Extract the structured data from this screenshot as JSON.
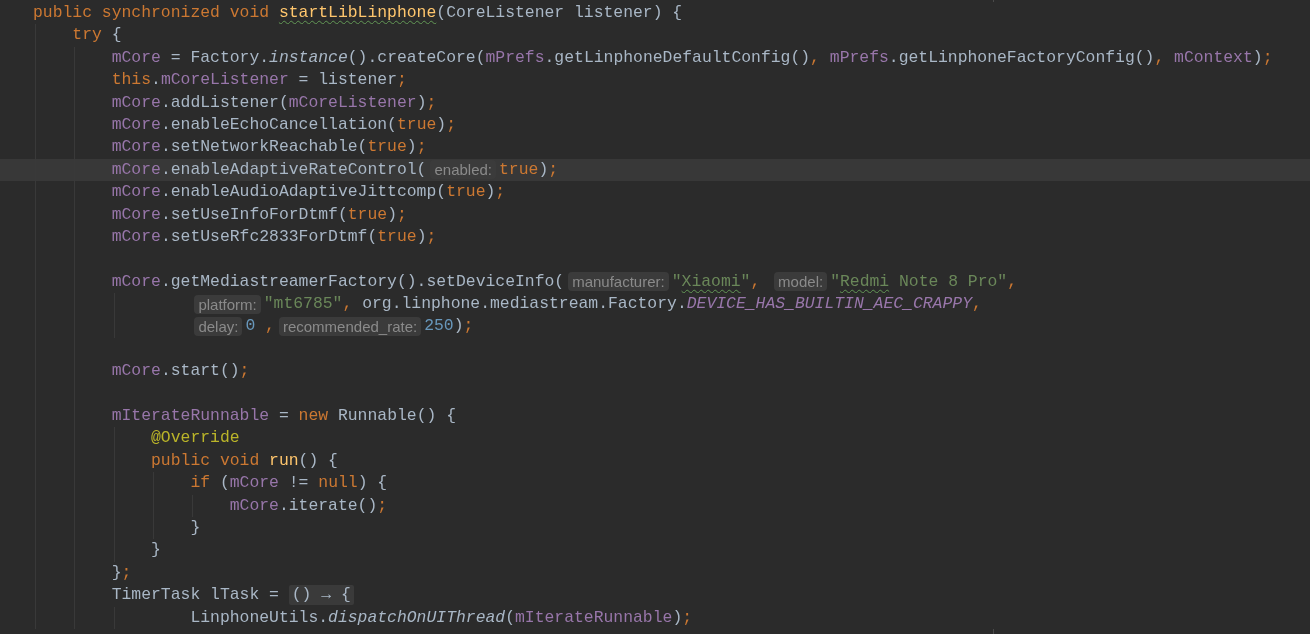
{
  "editor": {
    "lines": [
      {
        "kind": "code",
        "current": false,
        "segments": [
          {
            "kind": "code",
            "tokens": [
              {
                "kind": "kw",
                "text": "public synchronized void "
              },
              {
                "kind": "decl_misspelled",
                "text": "startLibLinphone"
              },
              {
                "kind": "plain",
                "text": "(CoreListener listener) {"
              }
            ]
          }
        ],
        "children": [
          {
            "kind": "code",
            "current": false,
            "segments": [
              {
                "kind": "code",
                "tokens": [
                  {
                    "kind": "kw",
                    "text": "try"
                  },
                  {
                    "kind": "plain",
                    "text": " {"
                  }
                ]
              }
            ],
            "children": [
              {
                "kind": "code",
                "current": false,
                "segments": [
                  {
                    "kind": "code",
                    "tokens": [
                      {
                        "kind": "field",
                        "text": "mCore"
                      },
                      {
                        "kind": "plain",
                        "text": " = Factory."
                      },
                      {
                        "kind": "static",
                        "text": "instance"
                      },
                      {
                        "kind": "plain",
                        "text": "().createCore("
                      },
                      {
                        "kind": "field",
                        "text": "mPrefs"
                      },
                      {
                        "kind": "plain",
                        "text": ".getLinphoneDefaultConfig()"
                      },
                      {
                        "kind": "punct",
                        "text": ", "
                      },
                      {
                        "kind": "field",
                        "text": "mPrefs"
                      },
                      {
                        "kind": "plain",
                        "text": ".getLinphoneFactoryConfig()"
                      },
                      {
                        "kind": "punct",
                        "text": ", "
                      },
                      {
                        "kind": "field",
                        "text": "mContext"
                      },
                      {
                        "kind": "plain",
                        "text": ")"
                      },
                      {
                        "kind": "punct",
                        "text": ";"
                      }
                    ]
                  }
                ]
              },
              {
                "kind": "code",
                "current": false,
                "segments": [
                  {
                    "kind": "code",
                    "tokens": [
                      {
                        "kind": "kw",
                        "text": "this"
                      },
                      {
                        "kind": "plain",
                        "text": "."
                      },
                      {
                        "kind": "field",
                        "text": "mCoreListener"
                      },
                      {
                        "kind": "plain",
                        "text": " = listener"
                      },
                      {
                        "kind": "punct",
                        "text": ";"
                      }
                    ]
                  }
                ]
              },
              {
                "kind": "code",
                "current": false,
                "segments": [
                  {
                    "kind": "code",
                    "tokens": [
                      {
                        "kind": "field",
                        "text": "mCore"
                      },
                      {
                        "kind": "plain",
                        "text": ".addListener("
                      },
                      {
                        "kind": "field",
                        "text": "mCoreListener"
                      },
                      {
                        "kind": "plain",
                        "text": ")"
                      },
                      {
                        "kind": "punct",
                        "text": ";"
                      }
                    ]
                  }
                ]
              },
              {
                "kind": "code",
                "current": false,
                "segments": [
                  {
                    "kind": "code",
                    "tokens": [
                      {
                        "kind": "field",
                        "text": "mCore"
                      },
                      {
                        "kind": "plain",
                        "text": ".enableEchoCancellation("
                      },
                      {
                        "kind": "kw",
                        "text": "true"
                      },
                      {
                        "kind": "plain",
                        "text": ")"
                      },
                      {
                        "kind": "punct",
                        "text": ";"
                      }
                    ]
                  }
                ]
              },
              {
                "kind": "code",
                "current": false,
                "segments": [
                  {
                    "kind": "code",
                    "tokens": [
                      {
                        "kind": "field",
                        "text": "mCore"
                      },
                      {
                        "kind": "plain",
                        "text": ".setNetworkReachable("
                      },
                      {
                        "kind": "kw",
                        "text": "true"
                      },
                      {
                        "kind": "plain",
                        "text": ")"
                      },
                      {
                        "kind": "punct",
                        "text": ";"
                      }
                    ]
                  }
                ]
              },
              {
                "kind": "code",
                "current": true,
                "segments": [
                  {
                    "kind": "code",
                    "tokens": [
                      {
                        "kind": "field",
                        "text": "mCore"
                      },
                      {
                        "kind": "plain",
                        "text": ".enableAdaptiveRateControl("
                      }
                    ]
                  },
                  {
                    "kind": "hint",
                    "text": "enabled:"
                  },
                  {
                    "kind": "code",
                    "tokens": [
                      {
                        "kind": "kw",
                        "text": "true"
                      },
                      {
                        "kind": "plain",
                        "text": ")"
                      },
                      {
                        "kind": "punct",
                        "text": ";"
                      }
                    ]
                  }
                ]
              },
              {
                "kind": "code",
                "current": false,
                "segments": [
                  {
                    "kind": "code",
                    "tokens": [
                      {
                        "kind": "field",
                        "text": "mCore"
                      },
                      {
                        "kind": "plain",
                        "text": ".enableAudioAdaptiveJittcomp("
                      },
                      {
                        "kind": "kw",
                        "text": "true"
                      },
                      {
                        "kind": "plain",
                        "text": ")"
                      },
                      {
                        "kind": "punct",
                        "text": ";"
                      }
                    ]
                  }
                ]
              },
              {
                "kind": "code",
                "current": false,
                "segments": [
                  {
                    "kind": "code",
                    "tokens": [
                      {
                        "kind": "field",
                        "text": "mCore"
                      },
                      {
                        "kind": "plain",
                        "text": ".setUseInfoForDtmf("
                      },
                      {
                        "kind": "kw",
                        "text": "true"
                      },
                      {
                        "kind": "plain",
                        "text": ")"
                      },
                      {
                        "kind": "punct",
                        "text": ";"
                      }
                    ]
                  }
                ]
              },
              {
                "kind": "code",
                "current": false,
                "segments": [
                  {
                    "kind": "code",
                    "tokens": [
                      {
                        "kind": "field",
                        "text": "mCore"
                      },
                      {
                        "kind": "plain",
                        "text": ".setUseRfc2833ForDtmf("
                      },
                      {
                        "kind": "kw",
                        "text": "true"
                      },
                      {
                        "kind": "plain",
                        "text": ")"
                      },
                      {
                        "kind": "punct",
                        "text": ";"
                      }
                    ]
                  }
                ]
              },
              {
                "kind": "blank"
              },
              {
                "kind": "code",
                "current": false,
                "segments": [
                  {
                    "kind": "code",
                    "tokens": [
                      {
                        "kind": "field",
                        "text": "mCore"
                      },
                      {
                        "kind": "plain",
                        "text": ".getMediastreamerFactory().setDeviceInfo("
                      }
                    ]
                  },
                  {
                    "kind": "hint",
                    "text": "manufacturer:"
                  },
                  {
                    "kind": "code",
                    "tokens": [
                      {
                        "kind": "str",
                        "text": "\""
                      },
                      {
                        "kind": "str_misspelled",
                        "text": "Xiaomi"
                      },
                      {
                        "kind": "str",
                        "text": "\""
                      },
                      {
                        "kind": "punct",
                        "text": ", "
                      }
                    ]
                  },
                  {
                    "kind": "hint",
                    "text": "model:"
                  },
                  {
                    "kind": "code",
                    "tokens": [
                      {
                        "kind": "str",
                        "text": "\""
                      },
                      {
                        "kind": "str_misspelled",
                        "text": "Redmi"
                      },
                      {
                        "kind": "str",
                        "text": " Note 8 Pro\""
                      },
                      {
                        "kind": "punct",
                        "text": ","
                      }
                    ]
                  }
                ],
                "children": [
                  {
                    "kind": "continuation",
                    "current": false,
                    "segments": [
                      {
                        "kind": "hint",
                        "text": "platform:"
                      },
                      {
                        "kind": "code",
                        "tokens": [
                          {
                            "kind": "str",
                            "text": "\"mt6785\""
                          },
                          {
                            "kind": "punct",
                            "text": ", "
                          },
                          {
                            "kind": "plain",
                            "text": "org.linphone.mediastream.Factory."
                          },
                          {
                            "kind": "constant",
                            "text": "DEVICE_HAS_BUILTIN_AEC_CRAPPY"
                          },
                          {
                            "kind": "punct",
                            "text": ","
                          }
                        ]
                      }
                    ]
                  },
                  {
                    "kind": "continuation",
                    "current": false,
                    "segments": [
                      {
                        "kind": "hint",
                        "text": "delay:"
                      },
                      {
                        "kind": "code",
                        "tokens": [
                          {
                            "kind": "num",
                            "text": "0"
                          },
                          {
                            "kind": "punct",
                            "text": " ,"
                          }
                        ]
                      },
                      {
                        "kind": "hint",
                        "text": "recommended_rate:"
                      },
                      {
                        "kind": "code",
                        "tokens": [
                          {
                            "kind": "num",
                            "text": "250"
                          },
                          {
                            "kind": "plain",
                            "text": ")"
                          },
                          {
                            "kind": "punct",
                            "text": ";"
                          }
                        ]
                      }
                    ]
                  }
                ]
              },
              {
                "kind": "blank"
              },
              {
                "kind": "code",
                "current": false,
                "segments": [
                  {
                    "kind": "code",
                    "tokens": [
                      {
                        "kind": "field",
                        "text": "mCore"
                      },
                      {
                        "kind": "plain",
                        "text": ".start()"
                      },
                      {
                        "kind": "punct",
                        "text": ";"
                      }
                    ]
                  }
                ]
              },
              {
                "kind": "blank"
              },
              {
                "kind": "code",
                "current": false,
                "segments": [
                  {
                    "kind": "code",
                    "tokens": [
                      {
                        "kind": "field",
                        "text": "mIterateRunnable"
                      },
                      {
                        "kind": "plain",
                        "text": " = "
                      },
                      {
                        "kind": "kw",
                        "text": "new"
                      },
                      {
                        "kind": "plain",
                        "text": " Runnable() {"
                      }
                    ]
                  }
                ],
                "children": [
                  {
                    "kind": "code",
                    "current": false,
                    "segments": [
                      {
                        "kind": "code",
                        "tokens": [
                          {
                            "kind": "ann",
                            "text": "@Override"
                          }
                        ]
                      }
                    ]
                  },
                  {
                    "kind": "code",
                    "current": false,
                    "segments": [
                      {
                        "kind": "code",
                        "tokens": [
                          {
                            "kind": "kw",
                            "text": "public void "
                          },
                          {
                            "kind": "decl",
                            "text": "run"
                          },
                          {
                            "kind": "plain",
                            "text": "() {"
                          }
                        ]
                      }
                    ],
                    "children": [
                      {
                        "kind": "code",
                        "current": false,
                        "segments": [
                          {
                            "kind": "code",
                            "tokens": [
                              {
                                "kind": "kw",
                                "text": "if"
                              },
                              {
                                "kind": "plain",
                                "text": " ("
                              },
                              {
                                "kind": "field",
                                "text": "mCore"
                              },
                              {
                                "kind": "plain",
                                "text": " != "
                              },
                              {
                                "kind": "kw",
                                "text": "null"
                              },
                              {
                                "kind": "plain",
                                "text": ") {"
                              }
                            ]
                          }
                        ],
                        "children": [
                          {
                            "kind": "code",
                            "current": false,
                            "segments": [
                              {
                                "kind": "code",
                                "tokens": [
                                  {
                                    "kind": "field",
                                    "text": "mCore"
                                  },
                                  {
                                    "kind": "plain",
                                    "text": ".iterate()"
                                  },
                                  {
                                    "kind": "punct",
                                    "text": ";"
                                  }
                                ]
                              }
                            ]
                          }
                        ]
                      },
                      {
                        "kind": "code",
                        "current": false,
                        "segments": [
                          {
                            "kind": "code",
                            "tokens": [
                              {
                                "kind": "plain",
                                "text": "}"
                              }
                            ]
                          }
                        ]
                      }
                    ]
                  },
                  {
                    "kind": "code",
                    "current": false,
                    "segments": [
                      {
                        "kind": "code",
                        "tokens": [
                          {
                            "kind": "plain",
                            "text": "}"
                          }
                        ]
                      }
                    ]
                  }
                ]
              },
              {
                "kind": "code",
                "current": false,
                "segments": [
                  {
                    "kind": "code",
                    "tokens": [
                      {
                        "kind": "plain",
                        "text": "}"
                      },
                      {
                        "kind": "punct",
                        "text": ";"
                      }
                    ]
                  }
                ]
              },
              {
                "kind": "code",
                "current": false,
                "segments": [
                  {
                    "kind": "code",
                    "tokens": [
                      {
                        "kind": "plain",
                        "text": "TimerTask lTask = "
                      }
                    ]
                  },
                  {
                    "kind": "fold",
                    "text": "() → {"
                  }
                ],
                "children": [
                  {
                    "kind": "continuation",
                    "current": false,
                    "segments": [
                      {
                        "kind": "code",
                        "tokens": [
                          {
                            "kind": "plain",
                            "text": "LinphoneUtils."
                          },
                          {
                            "kind": "static",
                            "text": "dispatchOnUIThread"
                          },
                          {
                            "kind": "plain",
                            "text": "("
                          },
                          {
                            "kind": "field",
                            "text": "mIterateRunnable"
                          },
                          {
                            "kind": "plain",
                            "text": ")"
                          },
                          {
                            "kind": "punct",
                            "text": ";"
                          }
                        ]
                      }
                    ]
                  }
                ]
              }
            ]
          }
        ]
      }
    ]
  }
}
